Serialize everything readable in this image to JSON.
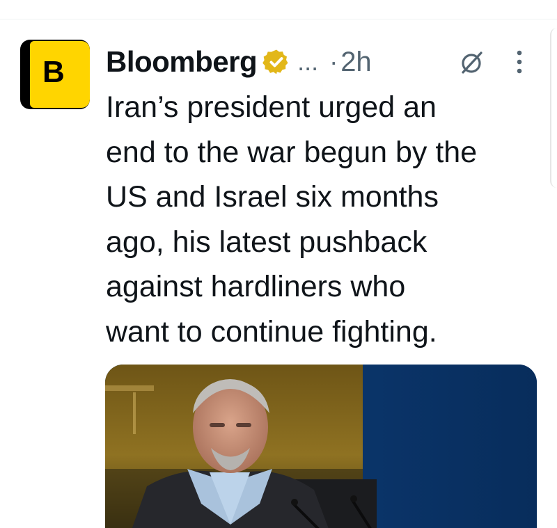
{
  "tweet": {
    "avatar": {
      "letter": "B",
      "colors": {
        "background": "#ffd500",
        "frame": "#000000"
      }
    },
    "author": {
      "name": "Bloomberg",
      "verified": true,
      "verified_color": "#e2b719",
      "handle_ellipsis": "...",
      "separator": "·",
      "time": "2h"
    },
    "actions": {
      "grok_icon": "grok-icon",
      "more_icon": "more-vertical-icon"
    },
    "text_lines": [
      "Iran’s president urged an",
      "end to the war begun by the",
      "US and Israel six months",
      "ago, his latest pushback",
      "against hardliners who",
      "want to continue fighting."
    ],
    "media": {
      "type": "photo",
      "colors": {
        "backdrop": "#0b3a74",
        "gold_wall": "#8a6a1c"
      }
    }
  }
}
